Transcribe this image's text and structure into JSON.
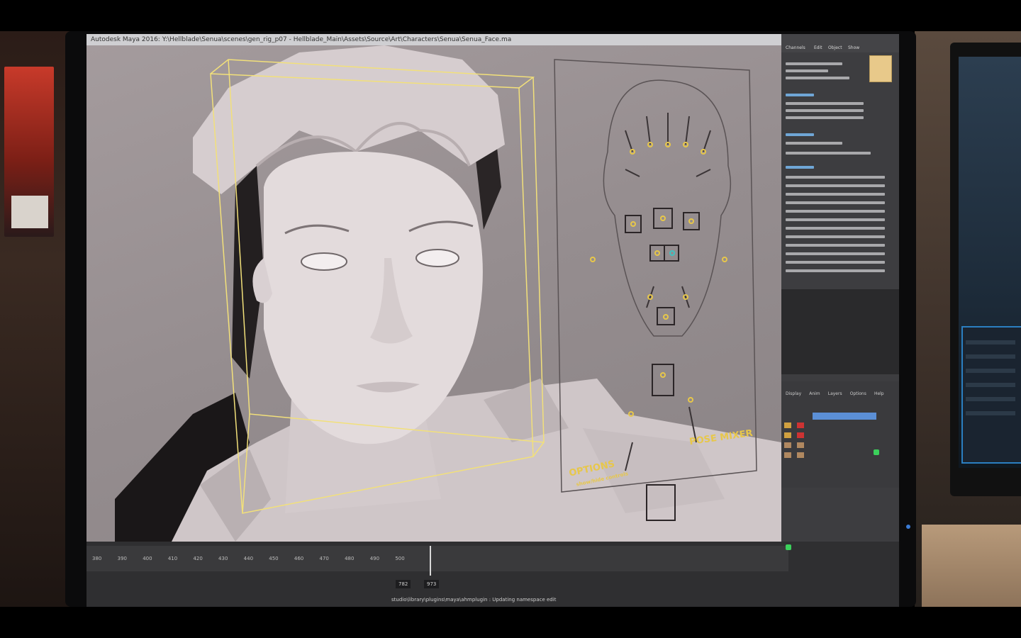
{
  "screen": {
    "title_bar": "Autodesk Maya 2016: Y:\\Hellblade\\Senua\\scenes\\gen_rig_p07 - Hellblade_Main\\Assets\\Source\\Art\\Characters\\Senua\\Senua_Face.ma",
    "viewport_labels": {
      "options": "OPTIONS",
      "options_sub": "show/hide controls",
      "pose_mixer": "POSE MIXER"
    },
    "right_panel": {
      "tabs": [
        "Channels",
        "Edit",
        "Object",
        "Show"
      ]
    },
    "layer_panel": {
      "tabs": [
        "Display",
        "Anim",
        "Layers",
        "Options",
        "Help"
      ]
    },
    "timeline": {
      "ticks": [
        "380",
        "390",
        "400",
        "410",
        "420",
        "430",
        "440",
        "450",
        "460",
        "470",
        "480",
        "490",
        "500"
      ],
      "current_frame": "782",
      "end_frame": "973",
      "status": "studio\\library\\plugins\\maya\\ahmplugin : Updating namespace edit"
    }
  },
  "colors": {
    "bezel": "#0b0b0c",
    "viewport": "#9a9294",
    "control_yellow": "#e7c74a",
    "bounding_box": "#f2e07a",
    "panel_dark": "#3d3d40",
    "selection_blue": "#5b8fd6"
  }
}
